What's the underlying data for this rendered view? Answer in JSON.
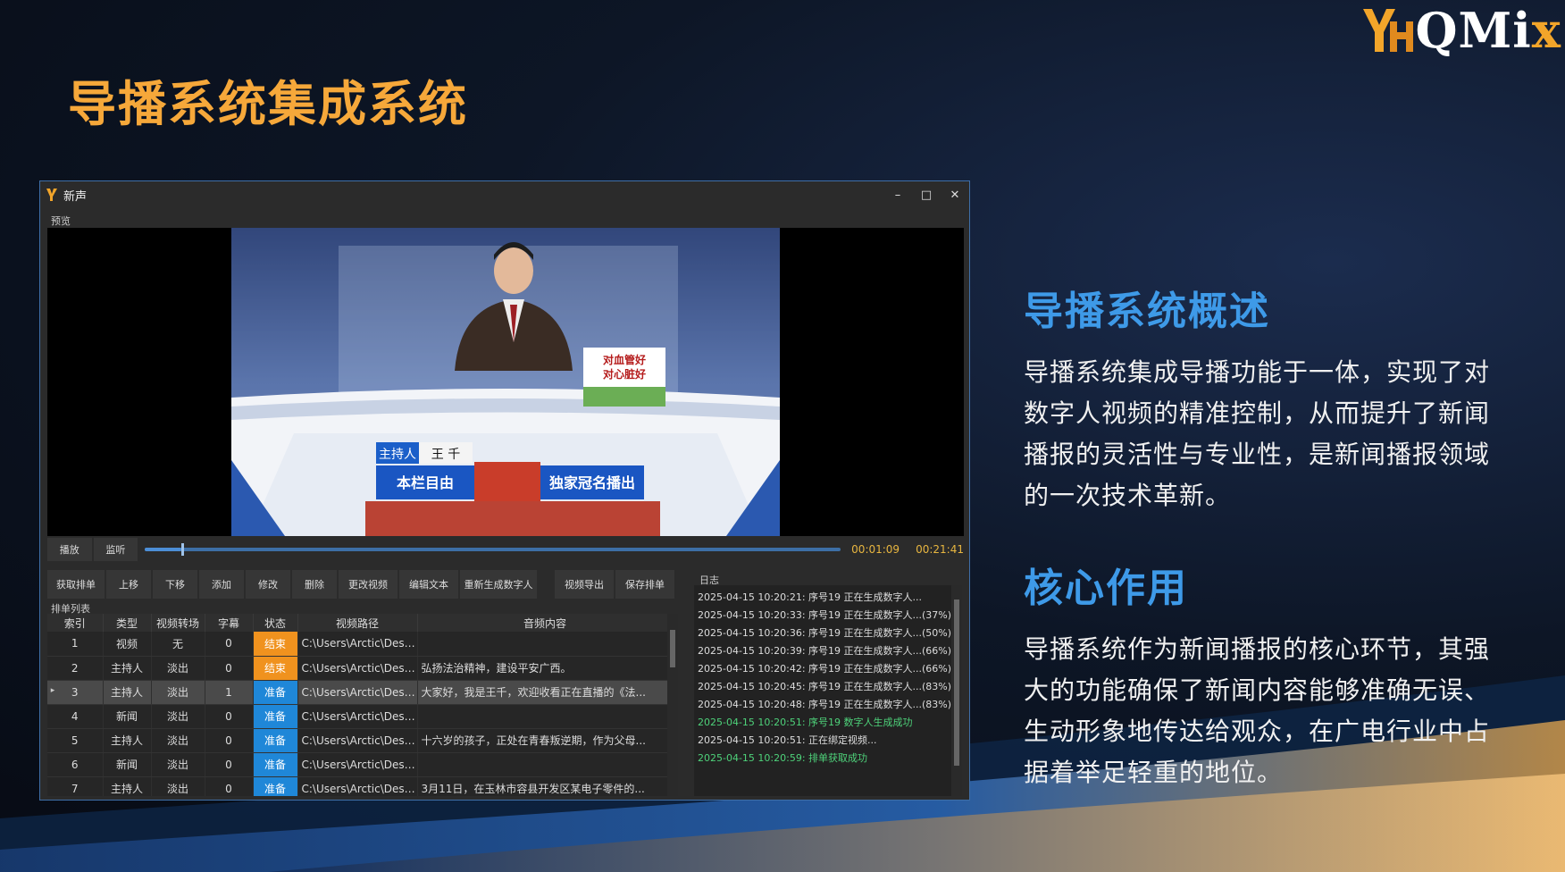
{
  "slide": {
    "title": "导播系统集成系统",
    "logo_text": "QMi",
    "logo_x": "x"
  },
  "window": {
    "title": "新声",
    "controls": {
      "minimize": "–",
      "maximize": "□",
      "close": "✕"
    },
    "preview_label": "预览",
    "video_overlay": {
      "anchor_tag": "主持人",
      "anchor_name": "王 千",
      "left_banner": "本栏目由",
      "right_banner": "独家冠名播出",
      "side_board": "对血管好 对心脏好"
    }
  },
  "playback": {
    "play_label": "播放",
    "monitor_label": "监听",
    "progress": 0.052,
    "current_time": "00:01:09",
    "total_time": "00:21:41"
  },
  "toolbar": {
    "buttons": [
      "获取排单",
      "上移",
      "下移",
      "添加",
      "修改",
      "删除",
      "更改视频",
      "编辑文本",
      "重新生成数字人"
    ],
    "export_label": "视频导出",
    "save_label": "保存排单"
  },
  "list": {
    "label": "排单列表",
    "columns": [
      "索引",
      "类型",
      "视频转场",
      "字幕",
      "状态",
      "视频路径",
      "音频内容"
    ],
    "rows": [
      [
        "1",
        "视频",
        "无",
        "0",
        "结束",
        "C:\\Users\\Arctic\\Deskt...",
        ""
      ],
      [
        "2",
        "主持人",
        "淡出",
        "0",
        "结束",
        "C:\\Users\\Arctic\\Deskt...",
        "弘扬法治精神，建设平安广西。"
      ],
      [
        "3",
        "主持人",
        "淡出",
        "1",
        "准备",
        "C:\\Users\\Arctic\\Deskt...",
        "大家好，我是王千，欢迎收看正在直播的《法..."
      ],
      [
        "4",
        "新闻",
        "淡出",
        "0",
        "准备",
        "C:\\Users\\Arctic\\Deskt...",
        ""
      ],
      [
        "5",
        "主持人",
        "淡出",
        "0",
        "准备",
        "C:\\Users\\Arctic\\Deskt...",
        "十六岁的孩子，正处在青春叛逆期，作为父母..."
      ],
      [
        "6",
        "新闻",
        "淡出",
        "0",
        "准备",
        "C:\\Users\\Arctic\\Deskt...",
        ""
      ],
      [
        "7",
        "主持人",
        "淡出",
        "0",
        "准备",
        "C:\\Users\\Arctic\\Deskt...",
        "3月11日，在玉林市容县开发区某电子零件的..."
      ]
    ],
    "selected_index": 2
  },
  "log": {
    "label": "日志",
    "lines": [
      {
        "text": "2025-04-15 10:20:21: 序号19 正在生成数字人...",
        "ok": false
      },
      {
        "text": "2025-04-15 10:20:33: 序号19 正在生成数字人...(37%)",
        "ok": false
      },
      {
        "text": "2025-04-15 10:20:36: 序号19 正在生成数字人...(50%)",
        "ok": false
      },
      {
        "text": "2025-04-15 10:20:39: 序号19 正在生成数字人...(66%)",
        "ok": false
      },
      {
        "text": "2025-04-15 10:20:42: 序号19 正在生成数字人...(66%)",
        "ok": false
      },
      {
        "text": "2025-04-15 10:20:45: 序号19 正在生成数字人...(83%)",
        "ok": false
      },
      {
        "text": "2025-04-15 10:20:48: 序号19 正在生成数字人...(83%)",
        "ok": false
      },
      {
        "text": "2025-04-15 10:20:51: 序号19 数字人生成成功",
        "ok": true
      },
      {
        "text": "2025-04-15 10:20:51: 正在绑定视频...",
        "ok": false
      },
      {
        "text": "2025-04-15 10:20:59: 排单获取成功",
        "ok": true
      }
    ]
  },
  "overview": {
    "heading": "导播系统概述",
    "body": "导播系统集成导播功能于一体，实现了对数字人视频的精准控制，从而提升了新闻播报的灵活性与专业性，是新闻播报领域的一次技术革新。"
  },
  "core": {
    "heading": "核心作用",
    "body": "导播系统作为新闻播报的核心环节，其强大的功能确保了新闻内容能够准确无误、生动形象地传达给观众，在广电行业中占据着举足轻重的地位。"
  },
  "colors": {
    "title_orange": "#f6a83a",
    "heading_blue": "#3e9ae8",
    "status_done": "#f0921e",
    "status_ready": "#1f87d8",
    "log_ok": "#4ed27a"
  }
}
